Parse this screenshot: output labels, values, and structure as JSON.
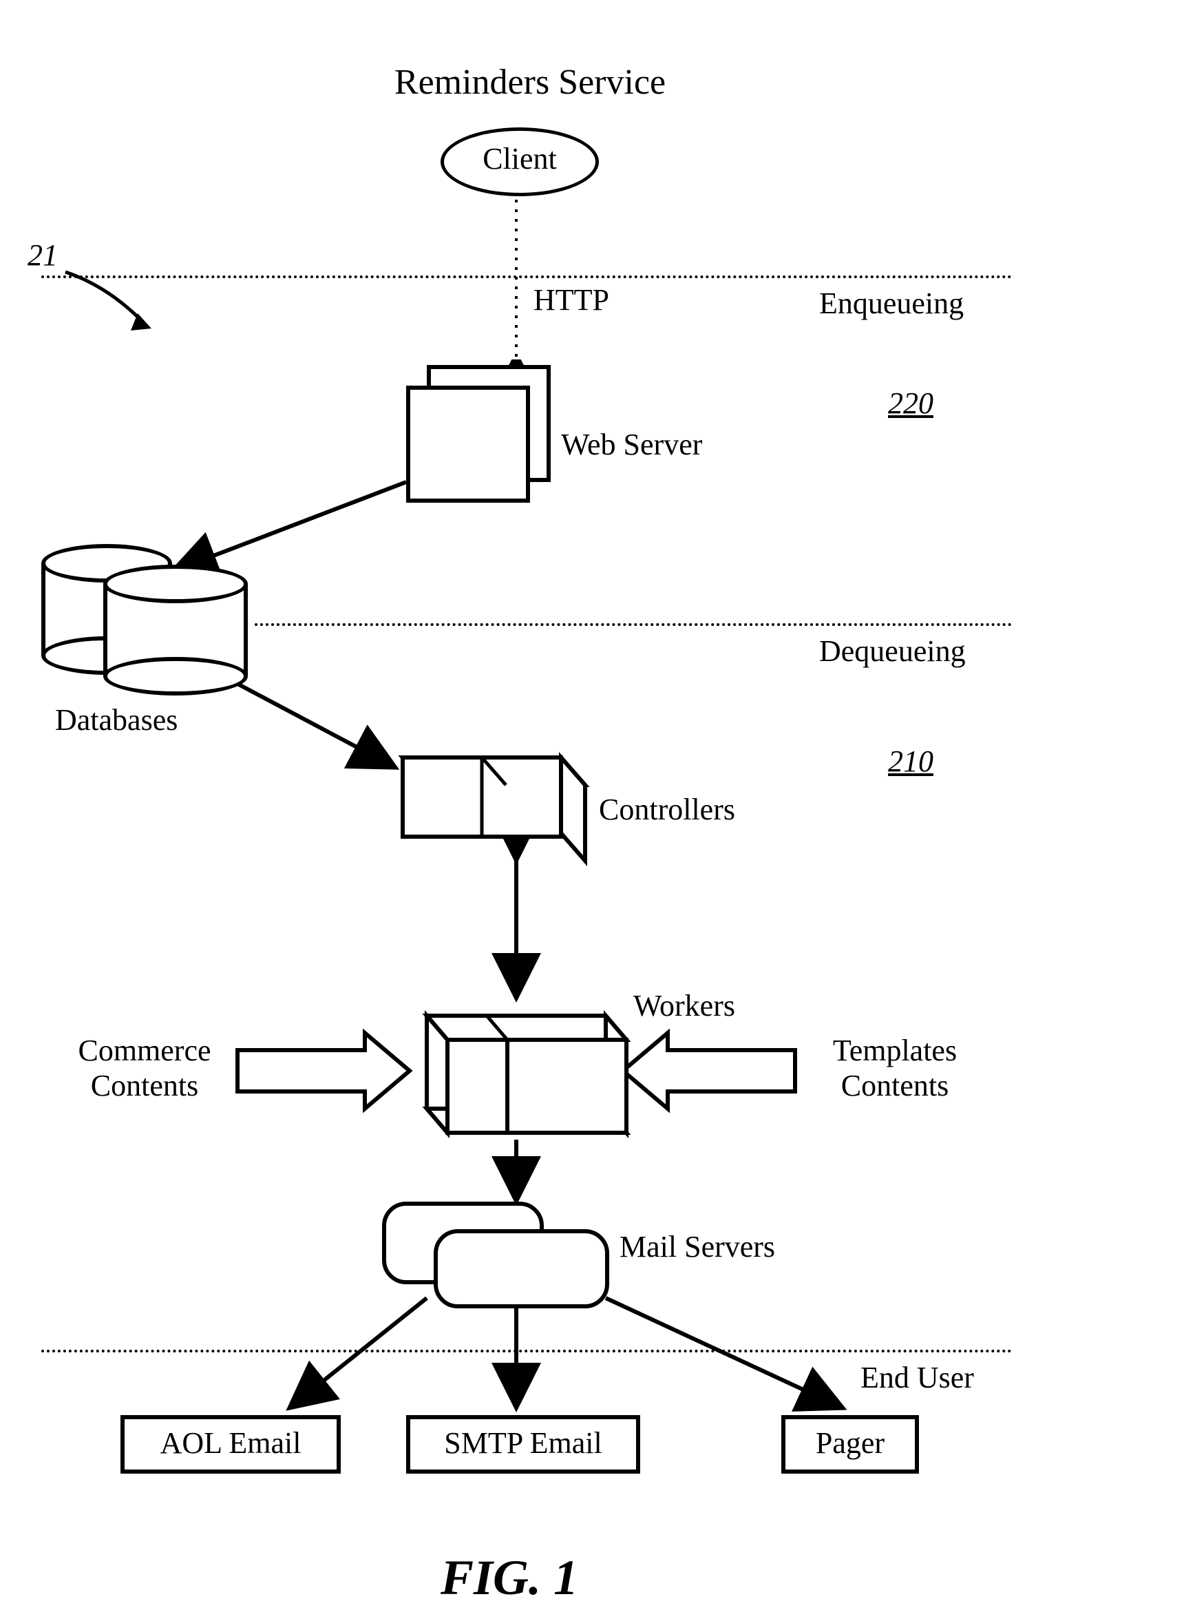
{
  "title": "Reminders Service",
  "ref_main": "21",
  "sections": {
    "enqueueing": {
      "label": "Enqueueing",
      "ref": "220"
    },
    "dequeueing": {
      "label": "Dequeueing",
      "ref": "210"
    },
    "enduser": {
      "label": "End User"
    }
  },
  "nodes": {
    "client": "Client",
    "http": "HTTP",
    "webserver": "Web Server",
    "databases": "Databases",
    "controllers": "Controllers",
    "workers": "Workers",
    "commerce": "Commerce\nContents",
    "templates": "Templates\nContents",
    "mailservers": "Mail Servers",
    "aol": "AOL Email",
    "smtp": "SMTP Email",
    "pager": "Pager"
  },
  "figure": "FIG. 1"
}
